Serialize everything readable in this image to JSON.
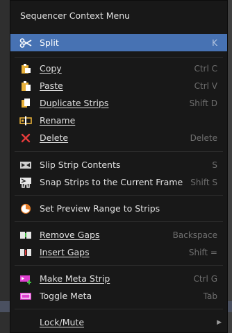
{
  "menu": {
    "title": "Sequencer Context Menu",
    "items": [
      {
        "label": "Split",
        "shortcut": "K"
      },
      {
        "label": "Copy",
        "shortcut": "Ctrl C"
      },
      {
        "label": "Paste",
        "shortcut": "Ctrl V"
      },
      {
        "label": "Duplicate Strips",
        "shortcut": "Shift D"
      },
      {
        "label": "Rename",
        "shortcut": ""
      },
      {
        "label": "Delete",
        "shortcut": "Delete"
      },
      {
        "label": "Slip Strip Contents",
        "shortcut": "S"
      },
      {
        "label": "Snap Strips to the Current Frame",
        "shortcut": "Shift S"
      },
      {
        "label": "Set Preview Range to Strips",
        "shortcut": ""
      },
      {
        "label": "Remove Gaps",
        "shortcut": "Backspace"
      },
      {
        "label": "Insert Gaps",
        "shortcut": "Shift ="
      },
      {
        "label": "Make Meta Strip",
        "shortcut": "Ctrl G"
      },
      {
        "label": "Toggle Meta",
        "shortcut": "Tab"
      },
      {
        "label": "Lock/Mute",
        "shortcut": ""
      }
    ]
  },
  "colors": {
    "menu_bg": "#181818",
    "active_bg": "#4772b3",
    "shortcut_text": "#6f6f6f",
    "delete_icon": "#e53b3b"
  }
}
